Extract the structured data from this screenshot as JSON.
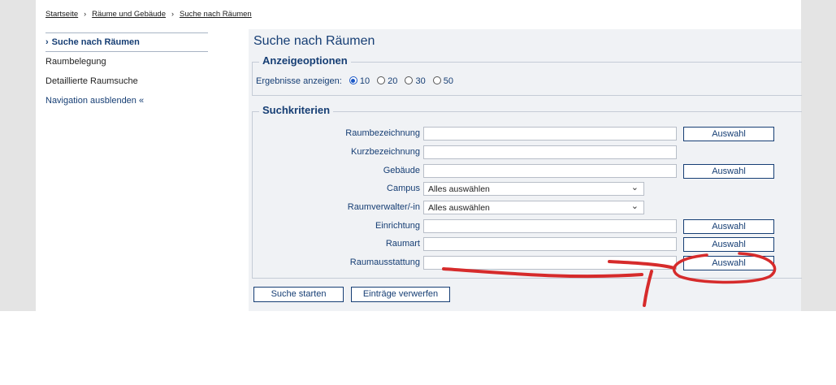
{
  "breadcrumb": {
    "home": "Startseite",
    "rooms_buildings": "Räume und Gebäude",
    "room_search": "Suche nach Räumen",
    "separator": "›"
  },
  "nav": {
    "active": {
      "chevron": "›",
      "label": "Suche nach Räumen"
    },
    "room_booking": "Raumbelegung",
    "detailed_search": "Detaillierte Raumsuche",
    "hide_nav": "Navigation ausblenden «"
  },
  "main": {
    "title": "Suche nach Räumen",
    "options": {
      "legend": "Anzeigeoptionen",
      "results_label": "Ergebnisse anzeigen:",
      "choices": [
        "10",
        "20",
        "30",
        "50"
      ],
      "selected": "10"
    },
    "criteria": {
      "legend": "Suchkriterien",
      "room_name_label": "Raumbezeichnung",
      "short_name_label": "Kurzbezeichnung",
      "building_label": "Gebäude",
      "campus_label": "Campus",
      "campus_value": "Alles auswählen",
      "room_manager_label": "Raumverwalter/-in",
      "room_manager_value": "Alles auswählen",
      "facility_label": "Einrichtung",
      "room_type_label": "Raumart",
      "equipment_label": "Raumausstattung",
      "select_button": "Auswahl"
    },
    "actions": {
      "search": "Suche starten",
      "discard": "Einträge verwerfen"
    }
  },
  "colors": {
    "accent": "#163e74",
    "annotation": "#d62b2b",
    "panel_bg": "#f0f2f5"
  }
}
